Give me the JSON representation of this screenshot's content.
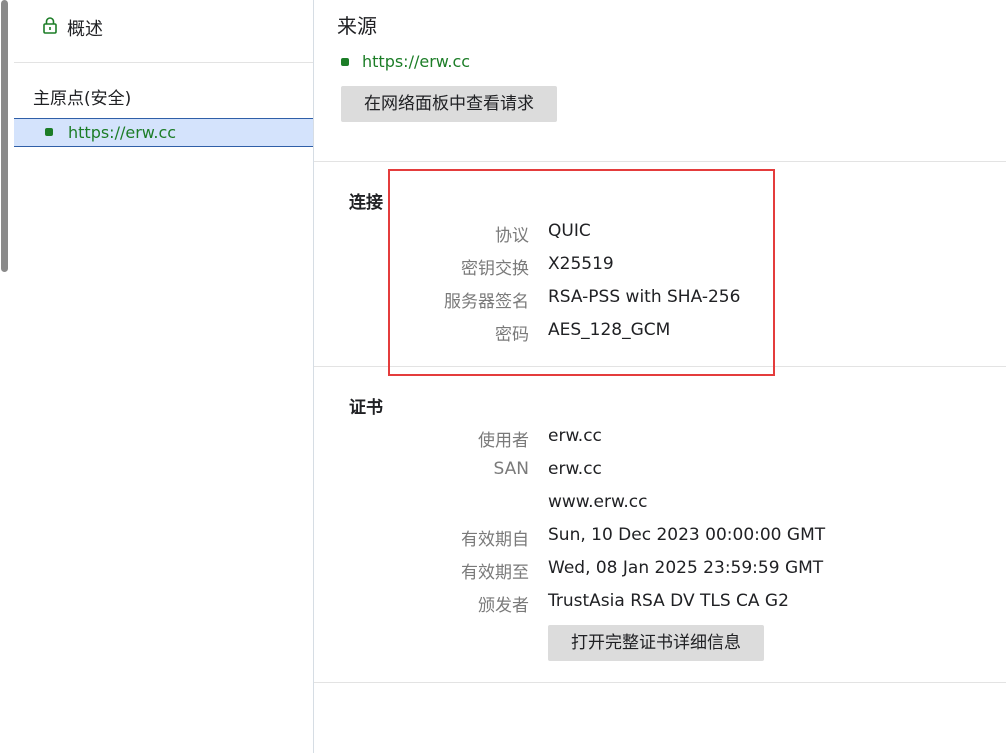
{
  "sidebar": {
    "overview_label": "概述",
    "origin_heading": "主原点(安全)",
    "origin_item_url": "https://erw.cc"
  },
  "source": {
    "title": "来源",
    "url": "https://erw.cc",
    "view_requests_button": "在网络面板中查看请求"
  },
  "connection": {
    "title": "连接",
    "rows": [
      {
        "label": "协议",
        "value": "QUIC"
      },
      {
        "label": "密钥交换",
        "value": "X25519"
      },
      {
        "label": "服务器签名",
        "value": "RSA-PSS with SHA-256"
      },
      {
        "label": "密码",
        "value": "AES_128_GCM"
      }
    ]
  },
  "certificate": {
    "title": "证书",
    "subject_label": "使用者",
    "subject_value": "erw.cc",
    "san_label": "SAN",
    "san_values": [
      "erw.cc",
      "www.erw.cc"
    ],
    "valid_from_label": "有效期自",
    "valid_from_value": "Sun, 10 Dec 2023 00:00:00 GMT",
    "valid_to_label": "有效期至",
    "valid_to_value": "Wed, 08 Jan 2025 23:59:59 GMT",
    "issuer_label": "颁发者",
    "issuer_value": "TrustAsia RSA DV TLS CA G2",
    "open_details_button": "打开完整证书详细信息"
  },
  "colors": {
    "secure_green": "#1c7d27",
    "selected_bg": "#d4e3fc",
    "highlight_red": "#e43c3c",
    "button_bg": "#dcdcdc"
  }
}
